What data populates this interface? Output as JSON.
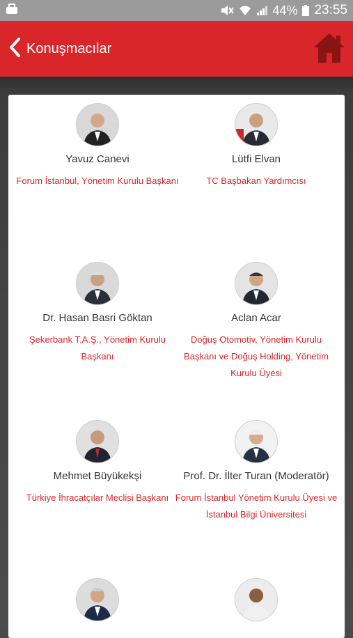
{
  "status": {
    "battery": "44%",
    "time": "23:55"
  },
  "header": {
    "title": "Konuşmacılar"
  },
  "speakers": [
    {
      "name": "Yavuz Canevi",
      "title": "Forum İstanbul, Yönetim Kurulu Başkanı"
    },
    {
      "name": "Lütfi Elvan",
      "title": "TC Başbakan Yardımcısı"
    },
    {
      "name": "Dr. Hasan Basri Göktan",
      "title": "Şekerbank T.A.Ş., Yönetim Kurulu Başkanı"
    },
    {
      "name": "Aclan Acar",
      "title": "Doğuş Otomotiv, Yönetim Kurulu Başkanı ve Doğuş Holding, Yönetim Kurulu Üyesi"
    },
    {
      "name": "Mehmet Büyükekşi",
      "title": "Türkiye İhracatçılar Meclisi Başkanı"
    },
    {
      "name": "Prof. Dr. İlter Turan (Moderatör)",
      "title": "Forum İstanbul Yönetim Kurulu Üyesi ve İstanbul Bilgi Üniversitesi"
    },
    {
      "name": "",
      "title": ""
    },
    {
      "name": "",
      "title": ""
    }
  ]
}
